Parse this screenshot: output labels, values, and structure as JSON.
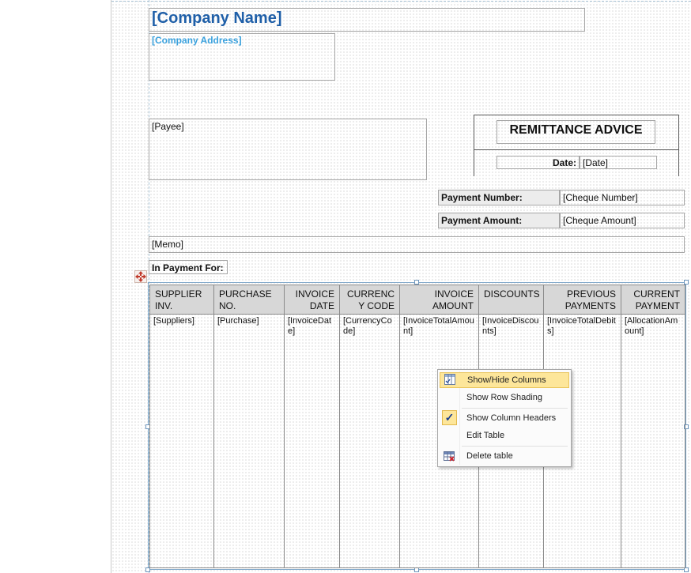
{
  "report": {
    "company_name": "[Company Name]",
    "company_address": "[Company Address]",
    "payee": "[Payee]",
    "title": "REMITTANCE ADVICE",
    "date_label": "Date:",
    "date_value": "[Date]",
    "payment_number_label": "Payment Number:",
    "payment_number_value": "[Cheque Number]",
    "payment_amount_label": "Payment Amount:",
    "payment_amount_value": "[Cheque Amount]",
    "memo": "[Memo]",
    "in_payment_for": "In Payment For:"
  },
  "table": {
    "columns": [
      {
        "header": "SUPPLIER INV.",
        "value": "[Suppliers]",
        "align": "left"
      },
      {
        "header": "PURCHASE NO.",
        "value": "[Purchase]",
        "align": "left"
      },
      {
        "header": "INVOICE DATE",
        "value": "[InvoiceDate]",
        "align": "right"
      },
      {
        "header": "CURRENCY CODE",
        "value": "[CurrencyCode]",
        "align": "right"
      },
      {
        "header": "INVOICE AMOUNT",
        "value": "[InvoiceTotalAmount]",
        "align": "right"
      },
      {
        "header": "DISCOUNTS",
        "value": "[InvoiceDiscounts]",
        "align": "left"
      },
      {
        "header": "PREVIOUS PAYMENTS",
        "value": "[InvoiceTotalDebits]",
        "align": "right"
      },
      {
        "header": "CURRENT PAYMENT",
        "value": "[AllocationAmount]",
        "align": "right"
      }
    ]
  },
  "context_menu": {
    "items": [
      {
        "label": "Show/Hide Columns",
        "icon": "columns-icon",
        "highlighted": true
      },
      {
        "label": "Show Row Shading"
      },
      {
        "label": "Show Column Headers",
        "icon": "checkmark-icon",
        "checked": true
      },
      {
        "label": "Edit Table"
      },
      {
        "label": "Delete table",
        "icon": "delete-table-icon"
      }
    ]
  },
  "colors": {
    "company_name": "#1f5fa8",
    "company_address": "#3aa1dd",
    "menu_highlight": "#fde69a",
    "header_fill": "#d7d7d7"
  }
}
